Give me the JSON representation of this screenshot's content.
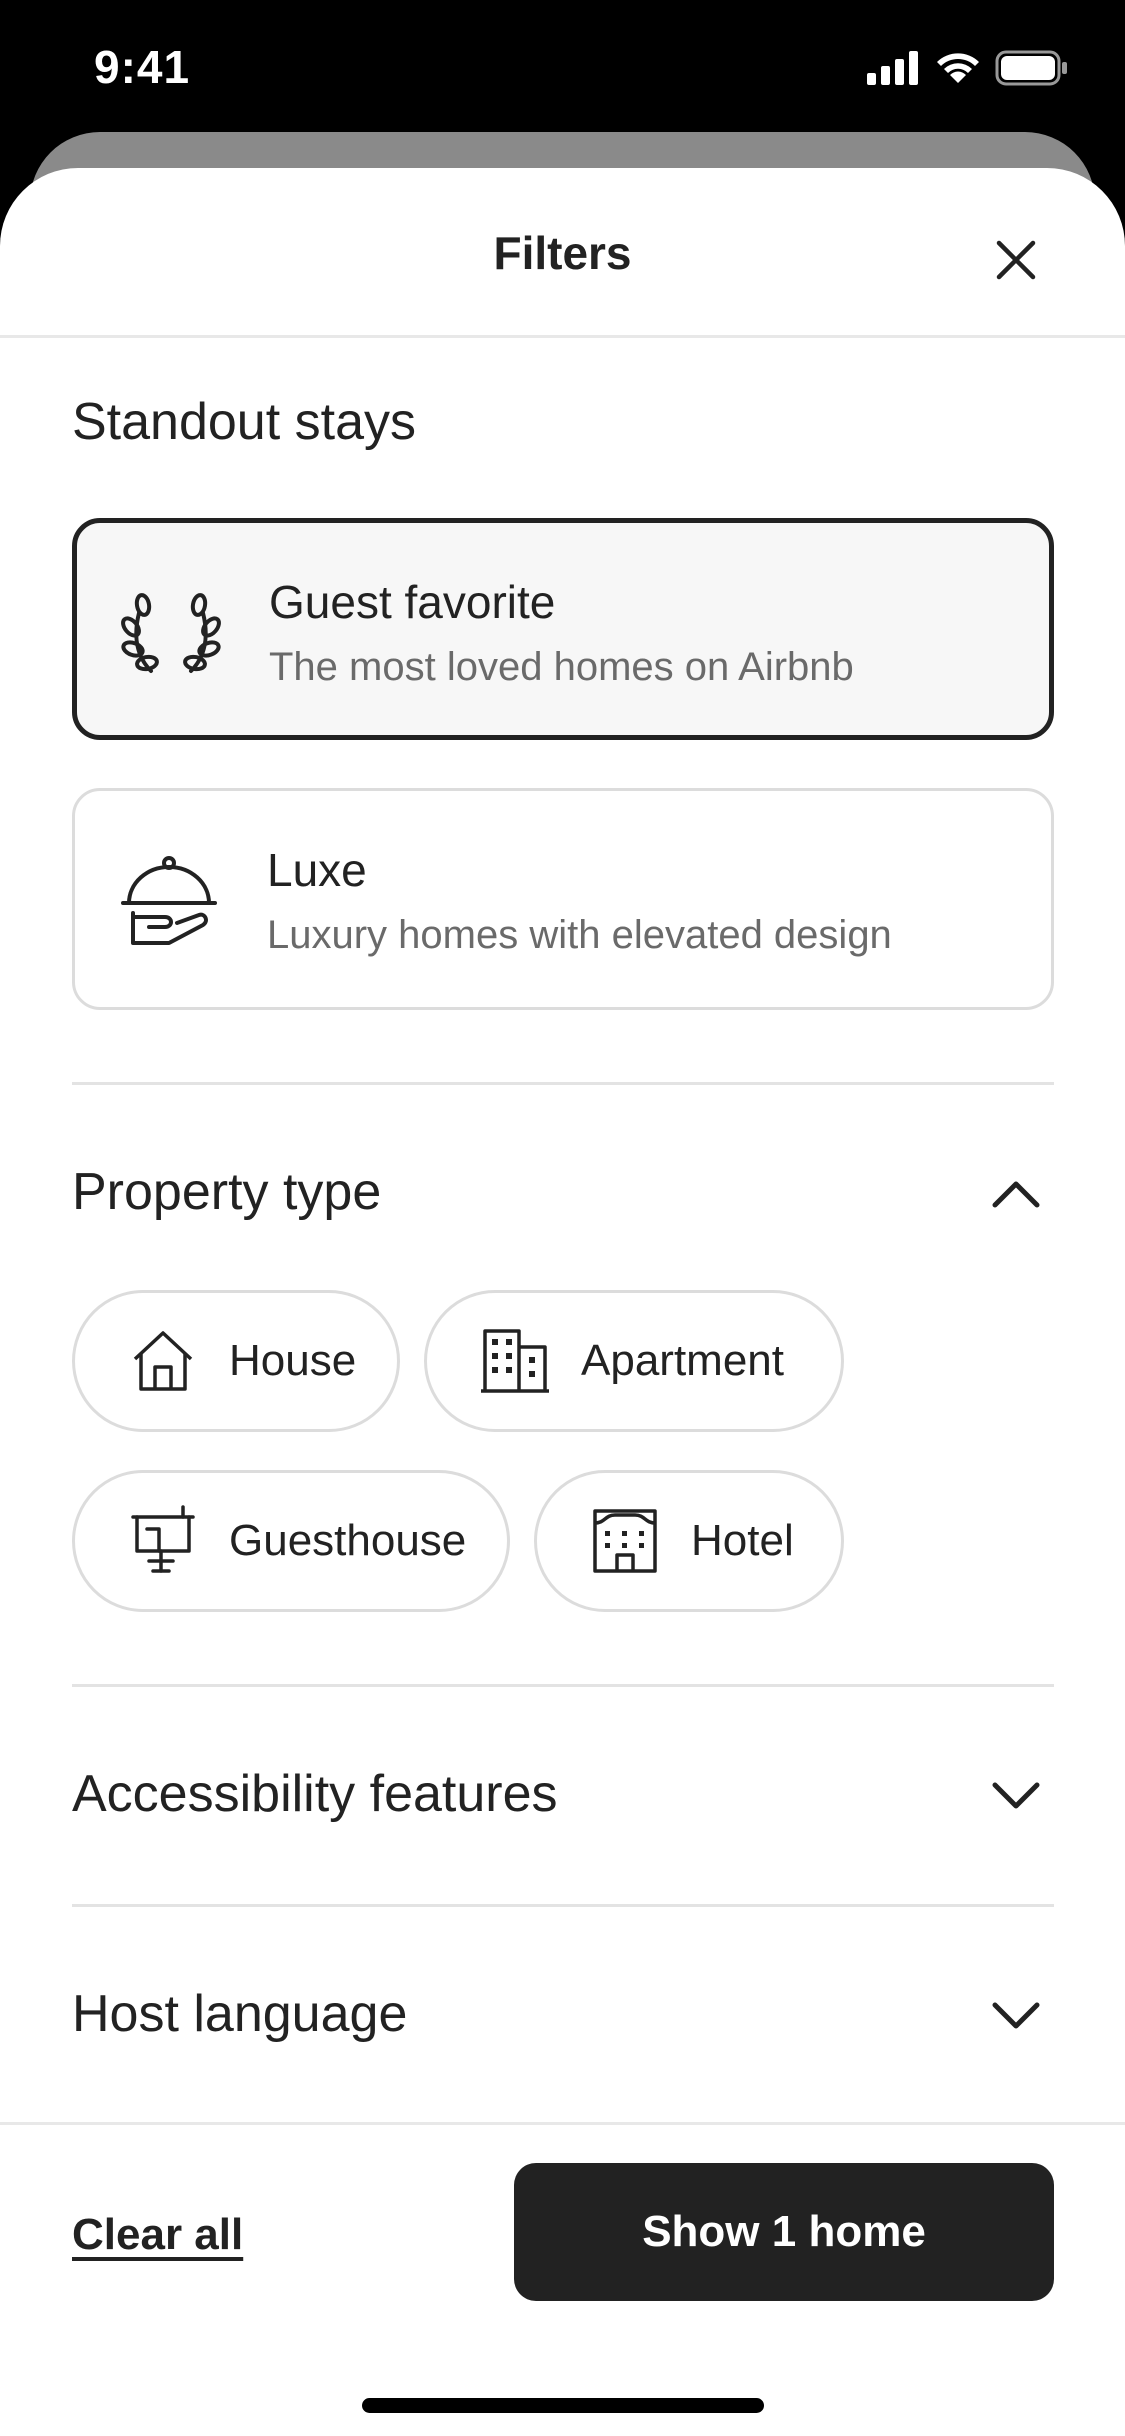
{
  "status_bar": {
    "time": "9:41"
  },
  "sheet": {
    "title": "Filters"
  },
  "standout": {
    "title": "Standout stays",
    "cards": [
      {
        "title": "Guest favorite",
        "subtitle": "The most loved homes on Airbnb",
        "icon": "laurel-icon",
        "selected": true
      },
      {
        "title": "Luxe",
        "subtitle": "Luxury homes with elevated design",
        "icon": "cloche-icon",
        "selected": false
      }
    ]
  },
  "property_type": {
    "title": "Property type",
    "expanded": true,
    "options": [
      {
        "label": "House",
        "icon": "house-icon"
      },
      {
        "label": "Apartment",
        "icon": "building-icon"
      },
      {
        "label": "Guesthouse",
        "icon": "guesthouse-icon"
      },
      {
        "label": "Hotel",
        "icon": "hotel-icon"
      }
    ]
  },
  "accessibility": {
    "title": "Accessibility features",
    "expanded": false
  },
  "host_language": {
    "title": "Host language",
    "expanded": false
  },
  "footer": {
    "clear_label": "Clear all",
    "show_label": "Show 1 home"
  },
  "colors": {
    "primary": "#222222",
    "secondary_text": "#6a6a6a",
    "border": "#dcdcdc",
    "selected_bg": "#f7f7f7"
  }
}
